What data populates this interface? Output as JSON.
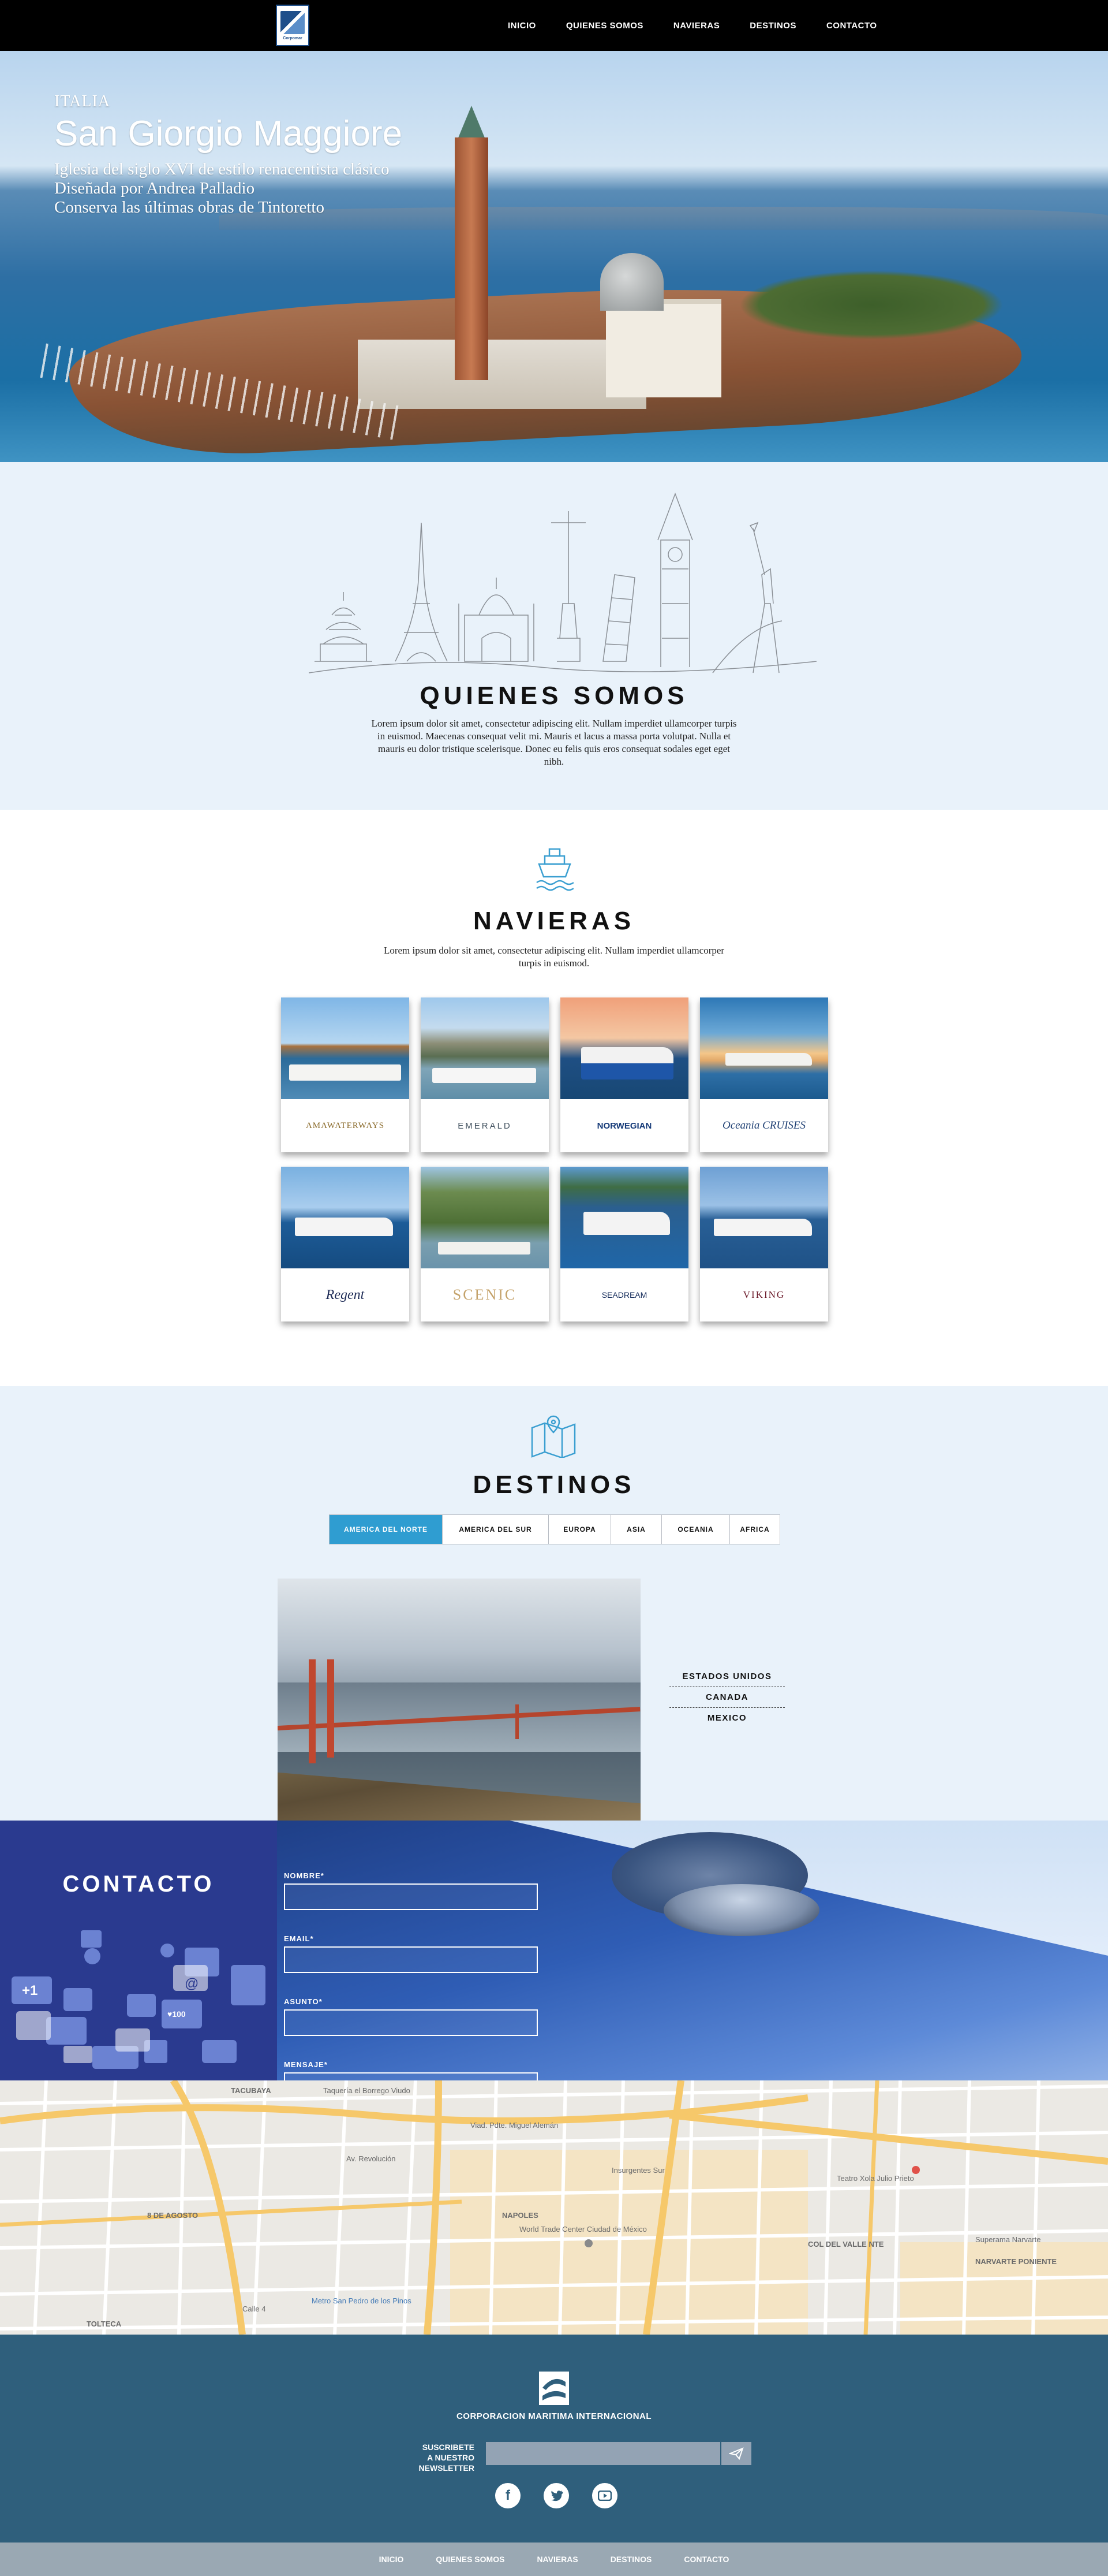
{
  "nav": {
    "logo_text": "Corpomar",
    "links": [
      "INICIO",
      "QUIENES SOMOS",
      "NAVIERAS",
      "DESTINOS",
      "CONTACTO"
    ]
  },
  "hero": {
    "country": "ITALIA",
    "title": "San Giorgio Maggiore",
    "lines": [
      "Iglesia del siglo XVI de estilo renacentista clásico",
      "Diseñada por Andrea Palladio",
      "Conserva las últimas obras de Tintoretto"
    ]
  },
  "quienes": {
    "title": "QUIENES SOMOS",
    "body": "Lorem ipsum dolor sit amet, consectetur adipiscing elit. Nullam imperdiet ullamcorper turpis in euismod. Maecenas consequat velit mi. Mauris et lacus a massa porta volutpat. Nulla et mauris eu dolor tristique scelerisque. Donec eu felis quis eros consequat sodales eget eget nibh."
  },
  "navieras": {
    "title": "NAVIERAS",
    "body": "Lorem ipsum dolor sit amet, consectetur adipiscing elit. Nullam imperdiet ullamcorper turpis in euismod.",
    "cards": [
      {
        "name": "AMAWATERWAYS",
        "sky": "#7fb6e6",
        "color": "#8a6a2a"
      },
      {
        "name": "EMERALD",
        "sky": "#9ec8ec",
        "color": "#40505e"
      },
      {
        "name": "NORWEGIAN",
        "sky": "#f0a07a",
        "color": "#153a78"
      },
      {
        "name": "Oceania CRUISES",
        "sky": "#f4c689",
        "color": "#1e3f73"
      },
      {
        "name": "Regent",
        "sky": "#79b0e0",
        "color": "#1c2a55"
      },
      {
        "name": "SCENIC",
        "sky": "#9fc6e4",
        "color": "#c4a26a"
      },
      {
        "name": "SEADREAM",
        "sky": "#5d9bd1",
        "color": "#142b5a"
      },
      {
        "name": "VIKING",
        "sky": "#6ea0d4",
        "color": "#6b1a2a"
      }
    ]
  },
  "destinos": {
    "title": "DESTINOS",
    "tabs": [
      "AMERICA DEL NORTE",
      "AMERICA DEL SUR",
      "EUROPA",
      "ASIA",
      "OCEANIA",
      "AFRICA"
    ],
    "active_tab": "AMERICA DEL NORTE",
    "list": [
      "ESTADOS UNIDOS",
      "CANADA",
      "MEXICO"
    ]
  },
  "contacto": {
    "title": "CONTACTO",
    "fields": [
      "NOMBRE*",
      "EMAIL*",
      "ASUNTO*",
      "MENSAJE*"
    ]
  },
  "map": {
    "labels": [
      "TACUBAYA",
      "Taquería el Borrego Viudo",
      "NAPOLES",
      "World Trade Center Ciudad de México",
      "COL DEL VALLE NTE",
      "NARVARTE PONIENTE",
      "Teatro Xola Julio Prieto",
      "Superama Narvarte",
      "TOLTECA",
      "Metro San Pedro de los Pinos",
      "8 DE AGOSTO",
      "Viad. Pdte. Miguel Alemán",
      "Av. Revolución",
      "Insurgentes Sur",
      "Calle 4"
    ]
  },
  "footer": {
    "company": "CORPORACION MARITIMA INTERNACIONAL",
    "newsletter_line1": "SUSCRIBETE",
    "newsletter_line2": "A NUESTRO NEWSLETTER",
    "social": [
      "facebook-icon",
      "twitter-icon",
      "youtube-icon"
    ],
    "links": [
      "INICIO",
      "QUIENES SOMOS",
      "NAVIERAS",
      "DESTINOS",
      "CONTACTO"
    ]
  }
}
